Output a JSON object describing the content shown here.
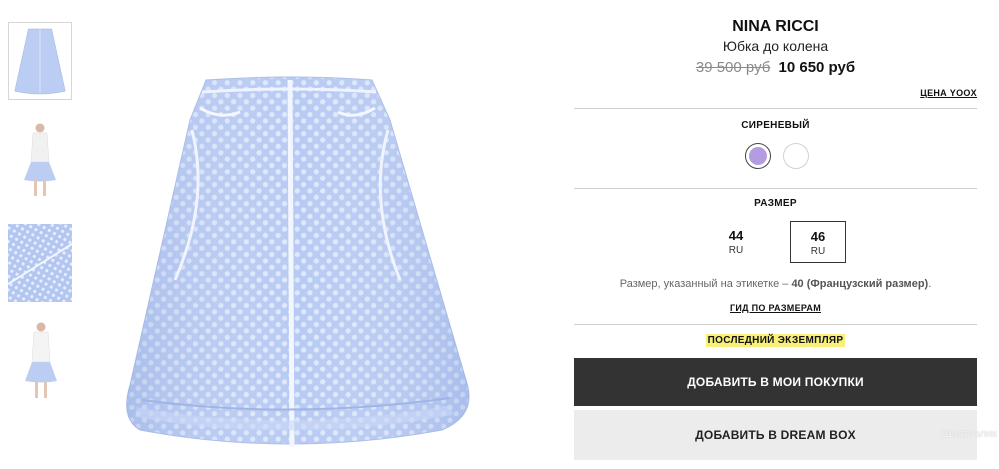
{
  "gallery": {
    "thumbnails": [
      {
        "icon": "skirt-front-thumbnail",
        "active": true
      },
      {
        "icon": "model-front-thumbnail",
        "active": false
      },
      {
        "icon": "fabric-detail-thumbnail",
        "active": false
      },
      {
        "icon": "model-side-thumbnail",
        "active": false
      }
    ],
    "main_image": "skirt-main-photo"
  },
  "product": {
    "brand": "NINA RICCI",
    "name": "Юбка до колена",
    "old_price": "39 500 руб",
    "new_price": "10 650 руб",
    "price_link": "ЦЕНА YOOX"
  },
  "color": {
    "label": "СИРЕНЕВЫЙ",
    "swatches": [
      {
        "name": "lilac",
        "hex": "#b49ce0",
        "selected": true
      },
      {
        "name": "white",
        "hex": "#ffffff",
        "selected": false
      }
    ]
  },
  "size": {
    "label": "РАЗМЕР",
    "options": [
      {
        "value": "44",
        "unit": "RU",
        "selected": false
      },
      {
        "value": "46",
        "unit": "RU",
        "selected": true
      }
    ],
    "note_prefix": "Размер, указанный на этикетке – ",
    "note_bold": "40 (Французский размер)",
    "note_suffix": ".",
    "guide_link": "ГИД ПО РАЗМЕРАМ"
  },
  "availability": "ПОСЛЕДНИЙ ЭКЗЕМПЛЯР",
  "actions": {
    "add_to_cart": "ДОБАВИТЬ В МОИ ПОКУПКИ",
    "add_to_dream_box": "ДОБАВИТЬ В DREAM BOX"
  },
  "watermark": "Шопоголик",
  "colors": {
    "button_dark": "#333333",
    "button_light": "#ececec",
    "highlight": "#f8f07a",
    "skirt": "#b9cbf2"
  }
}
